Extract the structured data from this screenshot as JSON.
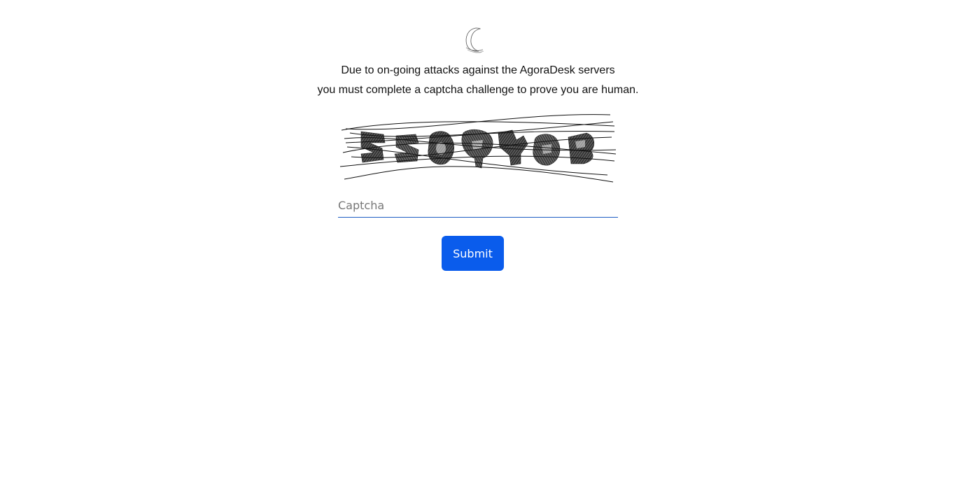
{
  "logo": {
    "icon": "moon-sailboat-icon"
  },
  "message": {
    "line1": "Due to on-going attacks against the AgoraDesk servers",
    "line2": "you must complete a captcha challenge to prove you are human."
  },
  "captcha_image": {
    "icon": "captcha-image"
  },
  "captcha_input": {
    "placeholder": "Captcha",
    "value": ""
  },
  "submit": {
    "label": "Submit"
  },
  "colors": {
    "accent": "#0a5cec",
    "input_underline": "#1d5cc4",
    "text": "#111111",
    "placeholder": "#777777"
  }
}
